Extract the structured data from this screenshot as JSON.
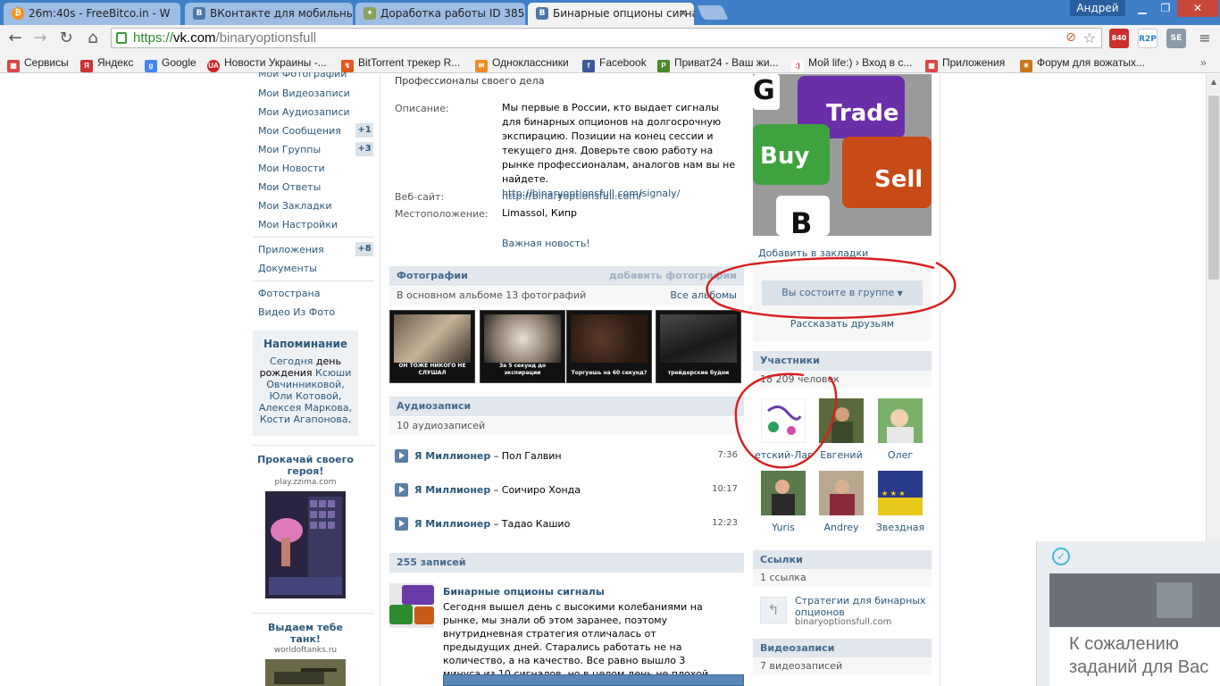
{
  "browser": {
    "tabs": [
      {
        "title": "26m:40s - FreeBitco.in - W",
        "icon": "bitcoin-icon",
        "color": "#f7931a"
      },
      {
        "title": "ВКонтакте для мобильны",
        "icon": "vk-icon",
        "color": "#4a76a8"
      },
      {
        "title": "Доработка работы ID 385",
        "icon": "doc-icon",
        "color": "#8aa35a"
      },
      {
        "title": "Бинарные опционы сигна",
        "icon": "vk-icon",
        "color": "#4a76a8"
      }
    ],
    "user": "Андрей",
    "url": {
      "scheme": "https://",
      "host": "vk.com",
      "path": "/binaryoptionsfull"
    },
    "mail_count": "840",
    "ext_r2p": "R2P",
    "ext_se": "SE",
    "bookmarks": [
      {
        "label": "Сервисы",
        "icon": "apps-icon"
      },
      {
        "label": "Яндекс",
        "icon": "yandex-icon"
      },
      {
        "label": "Google",
        "icon": "google-icon"
      },
      {
        "label": "Новости Украины -...",
        "icon": "news-icon"
      },
      {
        "label": "BitTorrent трекер R...",
        "icon": "torrent-icon"
      },
      {
        "label": "Одноклассники",
        "icon": "ok-icon"
      },
      {
        "label": "Facebook",
        "icon": "facebook-icon"
      },
      {
        "label": "Приват24 - Ваш жи...",
        "icon": "privat-icon"
      },
      {
        "label": "Мой life:) › Вход в с...",
        "icon": "life-icon"
      },
      {
        "label": "Приложения",
        "icon": "apps-icon"
      },
      {
        "label": "Форум для вожатых...",
        "icon": "forum-icon"
      }
    ]
  },
  "left_menu": {
    "items": [
      {
        "label": "Мои Фотографии"
      },
      {
        "label": "Мои Видеозаписи"
      },
      {
        "label": "Мои Аудиозаписи"
      },
      {
        "label": "Мои Сообщения",
        "badge": "+1"
      },
      {
        "label": "Мои Группы",
        "badge": "+3"
      },
      {
        "label": "Мои Новости"
      },
      {
        "label": "Мои Ответы"
      },
      {
        "label": "Мои Закладки"
      },
      {
        "label": "Мои Настройки"
      },
      {
        "label": "Приложения",
        "badge": "+8"
      },
      {
        "label": "Документы"
      },
      {
        "label": "Фотострана"
      },
      {
        "label": "Видео Из Фото"
      }
    ],
    "reminder": {
      "title": "Напоминание",
      "today": "Сегодня",
      "text1": "день рождения",
      "names": "Ксюши Овчинниковой, Юли Котовой, Алексея Маркова, Кости Агапонова",
      "end": "."
    },
    "ads": [
      {
        "title": "Прокачай своего героя!",
        "domain": "play.zzima.com"
      },
      {
        "title": "Выдаем тебе танк!",
        "domain": "worldoftanks.ru"
      }
    ]
  },
  "info": {
    "tagline": "Профессионалы своего дела",
    "description_label": "Описание:",
    "description": "Мы первые в России, кто выдает сигналы для бинарных опционов на долгосрочную экспирацию. Позиции на конец сессии и текущего дня. Доверьте свою работу на рынке профессионалам, аналогов нам вы не найдете.",
    "description_link": "http://binaryoptionsfull.com/signaly/",
    "website_label": "Веб-сайт:",
    "website": "http://binaryoptionsfull.com/",
    "location_label": "Местоположение:",
    "location": "Limassol, Кипр",
    "news_link": "Важная новость!"
  },
  "photos": {
    "title": "Фотографии",
    "add": "добавить фотографии",
    "subtitle": "В основном альбоме 13 фотографий",
    "all": "Все альбомы",
    "items": [
      {
        "caption": "ОН ТОЖЕ НИКОГО НЕ СЛУШАЛ"
      },
      {
        "caption": "За 5 секунд до экспирации"
      },
      {
        "caption": "Торгуешь на 60 секунд?"
      },
      {
        "caption": "трейдерские будни"
      }
    ]
  },
  "audio": {
    "title": "Аудиозаписи",
    "subtitle": "10 аудиозаписей",
    "tracks": [
      {
        "artist": "Я Миллионер",
        "title": " – Пол Галвин",
        "duration": "7:36"
      },
      {
        "artist": "Я Миллионер",
        "title": " – Соичиро Хонда",
        "duration": "10:17"
      },
      {
        "artist": "Я Миллионер",
        "title": " – Тадао Кашио",
        "duration": "12:23"
      }
    ]
  },
  "wall": {
    "count": "255 записей",
    "post_author": "Бинарные опционы сигналы",
    "post_text": "Сегодня вышел день с высокими колебаниями на рынке, мы знали об этом заранее, поэтому внутридневная стратегия отличалась от предыдущих дней. Старались работать не на количество, а на качество. Все равно вышло 3 минуса из 10 сигналов, но в целом день не плохой."
  },
  "right": {
    "cover_keys": [
      "G",
      "Trade",
      "Buy",
      "Sell",
      "B"
    ],
    "bookmark": "Добавить в закладки",
    "member_button": "Вы состоите в группе",
    "tell_friends": "Рассказать друзьям",
    "members_title": "Участники",
    "members_count": "18 209 человек",
    "members": [
      {
        "name": "етский-Лагер"
      },
      {
        "name": "Евгений"
      },
      {
        "name": "Олег"
      },
      {
        "name": "Yuris"
      },
      {
        "name": "Andrey"
      },
      {
        "name": "Звездная"
      }
    ],
    "links_title": "Ссылки",
    "links_count": "1 ссылка",
    "link_title": "Стратегии для бинарных опционов",
    "link_domain": "binaryoptionsfull.com",
    "videos_title": "Видеозаписи",
    "videos_count": "7 видеозаписей"
  },
  "notification": {
    "line1": "К сожалению",
    "line2": "заданий для Вас"
  }
}
